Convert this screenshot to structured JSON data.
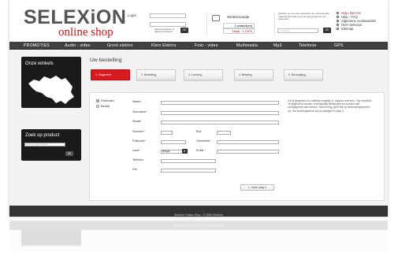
{
  "brand": {
    "name": "SELEXiON",
    "tagline": "online shop",
    "accent": "#c4161c"
  },
  "login": {
    "label": "Login",
    "forgot": "Paswoord gekozen of paswoord vergeten?",
    "ok": "OK"
  },
  "cart": {
    "icon": "cart-icon",
    "title": "Winkelmandje",
    "count": "1 product(en)",
    "total": "Totaal : 1.199 €"
  },
  "newsletter": {
    "text": "Schrijf je in op onze newsletter en ontvang elke maand informatie over nieuwe producten en promoties",
    "placeholder": "e-mail adres",
    "ok": "OK"
  },
  "links": [
    "Hulp: Bel ons",
    "Help - FAQ",
    "Algemene voorwaarden",
    "Over Selexion",
    "Sitemap"
  ],
  "nav": [
    "PROMOTIES",
    "Audio - video",
    "Groot elektro",
    "Klein Elektro",
    "Foto - video",
    "Multimedia",
    "Mp3",
    "Telefonie",
    "GPS"
  ],
  "sidebar": {
    "winkels_title": "Onze winkels",
    "map_icon": "belgium-map-icon",
    "zoek_title": "Zoek op product",
    "zoek_placeholder": "Zoek op product of merk",
    "zoek_ok": "OK"
  },
  "main": {
    "title": "Uw bestelling",
    "steps": [
      "1. Gegevens",
      "2. Bestelling",
      "3. Levering",
      "4. Betaling",
      "5. Bevestiging"
    ],
    "active_step": 0
  },
  "form": {
    "radio_particulier": "Particulier",
    "radio_bedrijf": "Bedrijf",
    "naam": "Naam",
    "voornaam": "Voornaam",
    "straat": "Straat",
    "nummer": "Nummer",
    "bus": "Bus",
    "postcode": "Postcode",
    "gemeente": "Gemeente",
    "land": "Land",
    "land_value": "Belgie",
    "email": "Email",
    "telefoon": "Telefoon",
    "fax": "Fax",
    "required_mark": "*",
    "info": "Vul je gegevens zo volledig mogelijk in, daarom met een * zijn verplicht. Je gegevens worden vertrouwelijk behandeld en worden niet doorgegeven aan derden. Opmerking: geef hier je facturatiegegevens op. Het leveringsadres kun je wijzigen in stap 3.",
    "next": "Naar stap 2"
  },
  "footer": "Selexion Online Shop - © 2009 Selexion"
}
